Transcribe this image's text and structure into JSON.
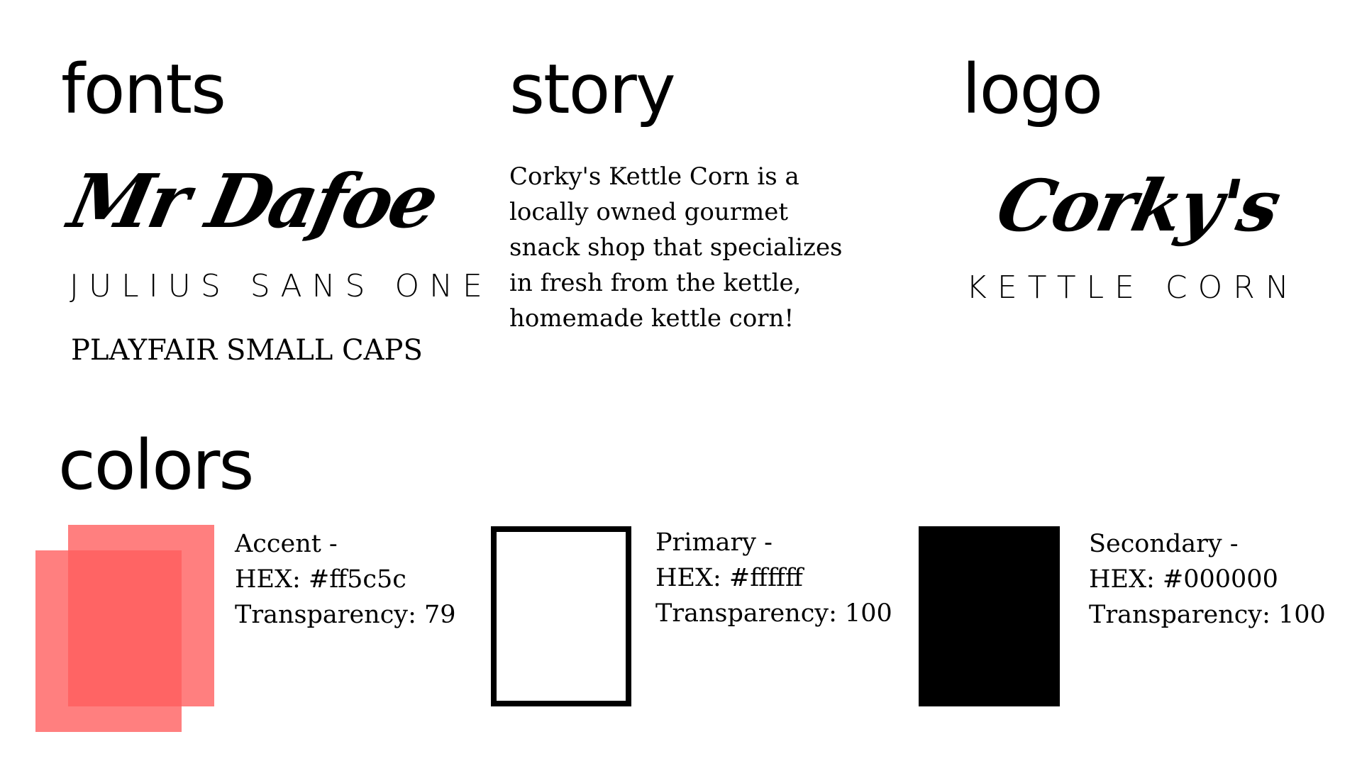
{
  "fonts": {
    "heading": "fonts",
    "samples": {
      "script": "Mr Dafoe",
      "sans": "JULIUS SANS ONE",
      "serif": "PLAYFAIR SMALL CAPS"
    }
  },
  "story": {
    "heading": "story",
    "lines": [
      "Corky's Kettle Corn is a",
      "locally owned gourmet",
      "snack shop that specializes",
      "in fresh from the kettle,",
      "homemade kettle corn!"
    ]
  },
  "logo": {
    "heading": "logo",
    "wordmark": "Corky's",
    "tagline": "KETTLE CORN"
  },
  "colors": {
    "heading": "colors",
    "swatches": [
      {
        "name_line": "Accent -",
        "hex_line": "HEX: #ff5c5c",
        "transparency_line": "Transparency: 79",
        "hex": "#ff5c5c",
        "transparency": 79
      },
      {
        "name_line": "Primary -",
        "hex_line": "HEX: #ffffff",
        "transparency_line": "Transparency: 100",
        "hex": "#ffffff",
        "transparency": 100
      },
      {
        "name_line": "Secondary -",
        "hex_line": "HEX: #000000",
        "transparency_line": "Transparency: 100",
        "hex": "#000000",
        "transparency": 100
      }
    ]
  }
}
